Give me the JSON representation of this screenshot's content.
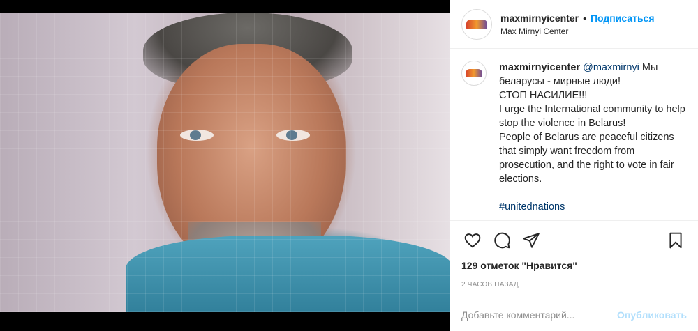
{
  "post": {
    "username": "maxmirnyicenter",
    "separator": "•",
    "follow_label": "Подписаться",
    "subtitle": "Max Mirnyi Center",
    "caption": {
      "username": "maxmirnyicenter",
      "mention": "@maxmirnyi",
      "lines": [
        "Мы беларусы - мирные люди!",
        "СТОП НАСИЛИЕ!!!",
        "I urge the International community to help stop the violence in Belarus!",
        "People of Belarus are peaceful citizens that simply want freedom from prosecution, and the right to vote in fair elections."
      ],
      "hashtag": "#unitednations"
    },
    "likes": "129 отметок \"Нравится\"",
    "time": "2 часов назад",
    "comment_placeholder": "Добавьте комментарий...",
    "publish_label": "Опубликовать",
    "icons": [
      "heart-icon",
      "comment-icon",
      "share-icon",
      "bookmark-icon"
    ]
  }
}
